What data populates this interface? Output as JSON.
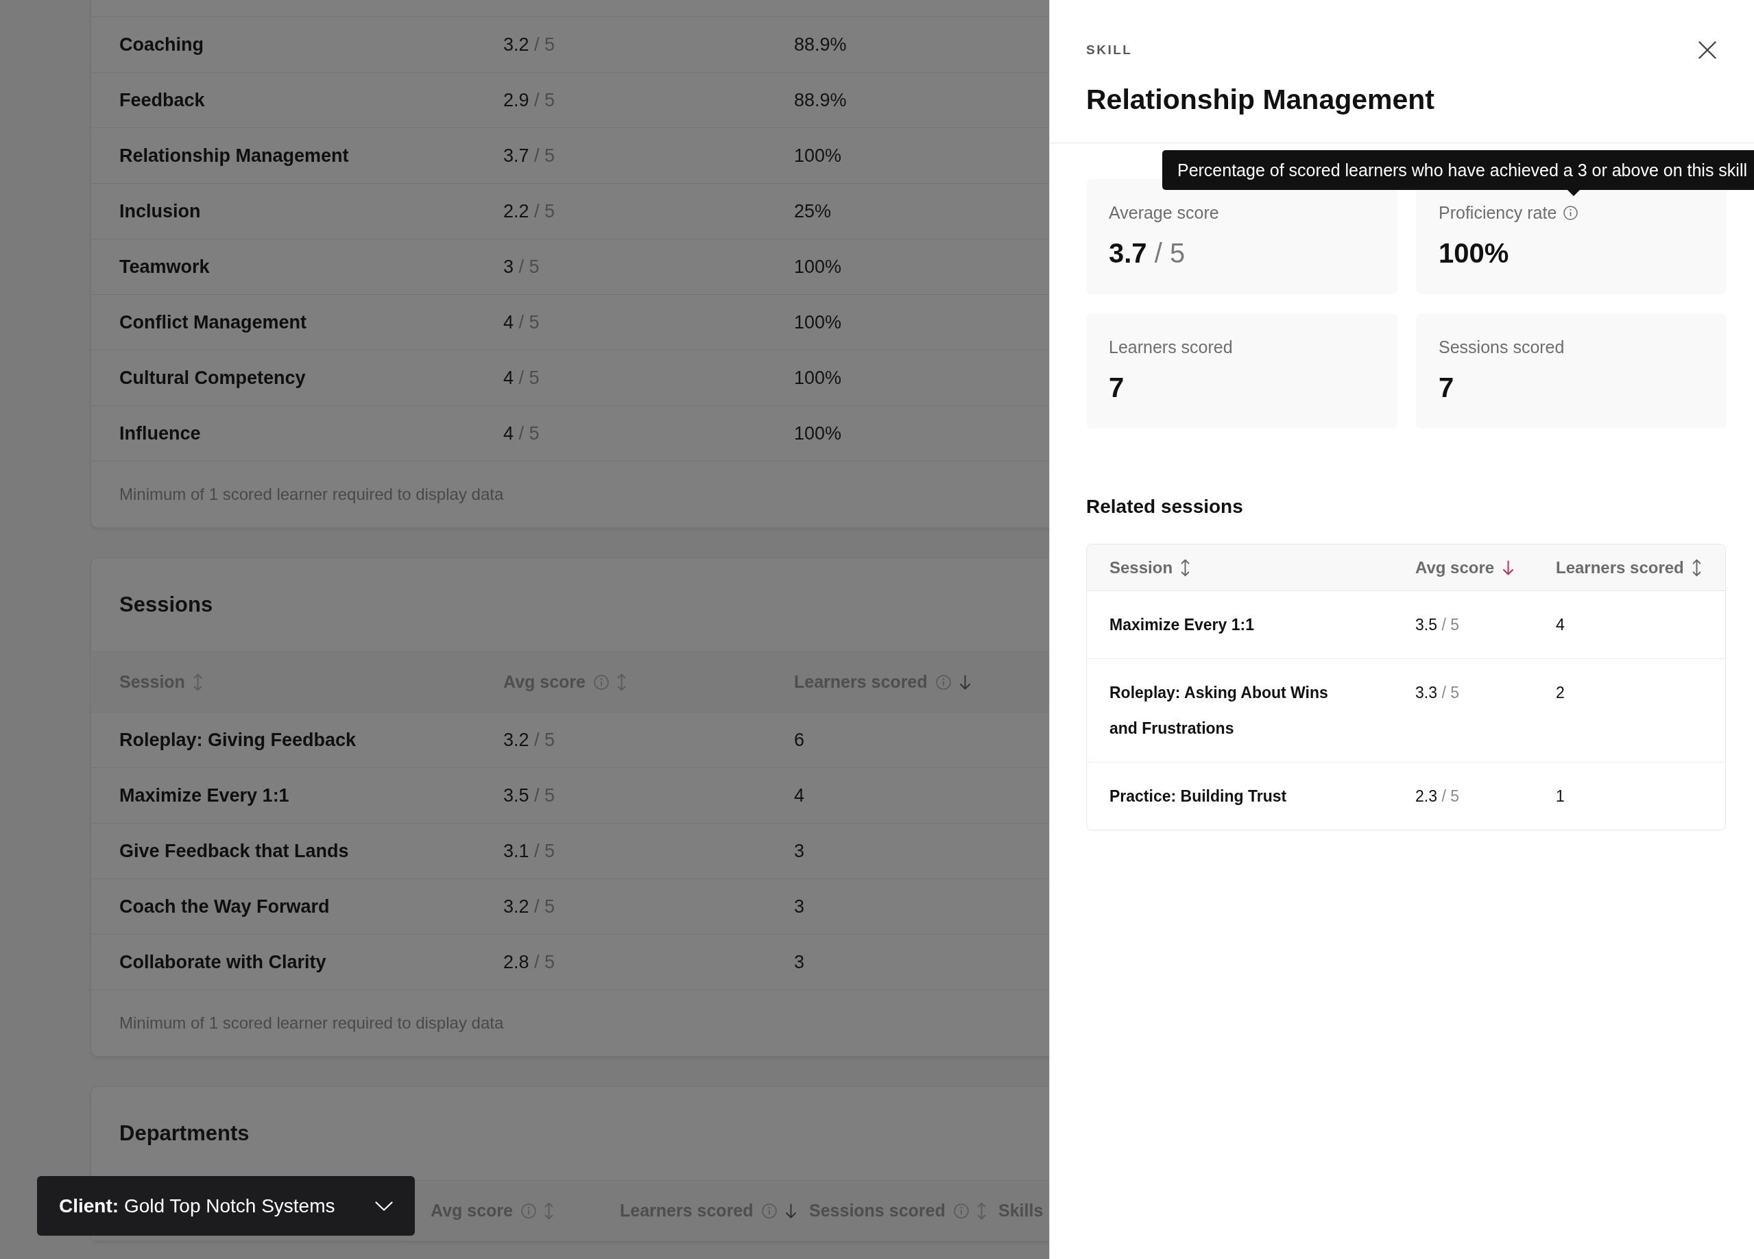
{
  "skills_table": {
    "rows": [
      {
        "skill": "Coaching",
        "avg_score": "3.2",
        "out_of": "/ 5",
        "proficiency_rate": "88.9%"
      },
      {
        "skill": "Feedback",
        "avg_score": "2.9",
        "out_of": "/ 5",
        "proficiency_rate": "88.9%"
      },
      {
        "skill": "Relationship Management",
        "avg_score": "3.7",
        "out_of": "/ 5",
        "proficiency_rate": "100%"
      },
      {
        "skill": "Inclusion",
        "avg_score": "2.2",
        "out_of": "/ 5",
        "proficiency_rate": "25%"
      },
      {
        "skill": "Teamwork",
        "avg_score": "3",
        "out_of": "/ 5",
        "proficiency_rate": "100%"
      },
      {
        "skill": "Conflict Management",
        "avg_score": "4",
        "out_of": "/ 5",
        "proficiency_rate": "100%"
      },
      {
        "skill": "Cultural Competency",
        "avg_score": "4",
        "out_of": "/ 5",
        "proficiency_rate": "100%"
      },
      {
        "skill": "Influence",
        "avg_score": "4",
        "out_of": "/ 5",
        "proficiency_rate": "100%"
      }
    ],
    "footnote": "Minimum of 1 scored learner required to display data"
  },
  "sessions": {
    "title": "Sessions",
    "columns": [
      {
        "label": "Session",
        "info": false,
        "sorted": false
      },
      {
        "label": "Avg score",
        "info": true,
        "sorted": false
      },
      {
        "label": "Learners scored",
        "info": true,
        "sorted": true
      }
    ],
    "rows": [
      {
        "session": "Roleplay: Giving Feedback",
        "avg_score": "3.2",
        "out_of": "/ 5",
        "learners_scored": "6"
      },
      {
        "session": "Maximize Every 1:1",
        "avg_score": "3.5",
        "out_of": "/ 5",
        "learners_scored": "4"
      },
      {
        "session": "Give Feedback that Lands",
        "avg_score": "3.1",
        "out_of": "/ 5",
        "learners_scored": "3"
      },
      {
        "session": "Coach the Way Forward",
        "avg_score": "3.2",
        "out_of": "/ 5",
        "learners_scored": "3"
      },
      {
        "session": "Collaborate with Clarity",
        "avg_score": "2.8",
        "out_of": "/ 5",
        "learners_scored": "3"
      }
    ],
    "footnote": "Minimum of 1 scored learner required to display data"
  },
  "departments": {
    "title": "Departments",
    "columns": [
      {
        "label": "Avg score",
        "info": true,
        "sorted": false
      },
      {
        "label": "Learners scored",
        "info": true,
        "sorted": true
      },
      {
        "label": "Sessions scored",
        "info": true,
        "sorted": false
      },
      {
        "label": "Skills"
      }
    ]
  },
  "client_selector": {
    "label": "Client:",
    "value": "Gold Top Notch Systems"
  },
  "skill_panel": {
    "eyebrow": "SKILL",
    "title": "Relationship Management",
    "stats": [
      {
        "label": "Average score",
        "value": "3.7",
        "out_of": "/ 5",
        "info": false
      },
      {
        "label": "Proficiency rate",
        "value": "100%",
        "info": true,
        "tooltip": "Percentage of scored learners who have achieved a 3 or above on this skill"
      },
      {
        "label": "Learners scored",
        "value": "7",
        "info": false
      },
      {
        "label": "Sessions scored",
        "value": "7",
        "info": false
      }
    ],
    "related_sessions": {
      "title": "Related sessions",
      "columns": [
        {
          "label": "Session",
          "sorted": false
        },
        {
          "label": "Avg score",
          "sorted": true
        },
        {
          "label": "Learners scored",
          "sorted": false
        }
      ],
      "rows": [
        {
          "session": "Maximize Every 1:1",
          "avg_score": "3.5",
          "out_of": "/ 5",
          "learners_scored": "4"
        },
        {
          "session": "Roleplay: Asking About Wins and Frustrations",
          "avg_score": "3.3",
          "out_of": "/ 5",
          "learners_scored": "2"
        },
        {
          "session": "Practice: Building Trust",
          "avg_score": "2.3",
          "out_of": "/ 5",
          "learners_scored": "1"
        }
      ]
    }
  }
}
